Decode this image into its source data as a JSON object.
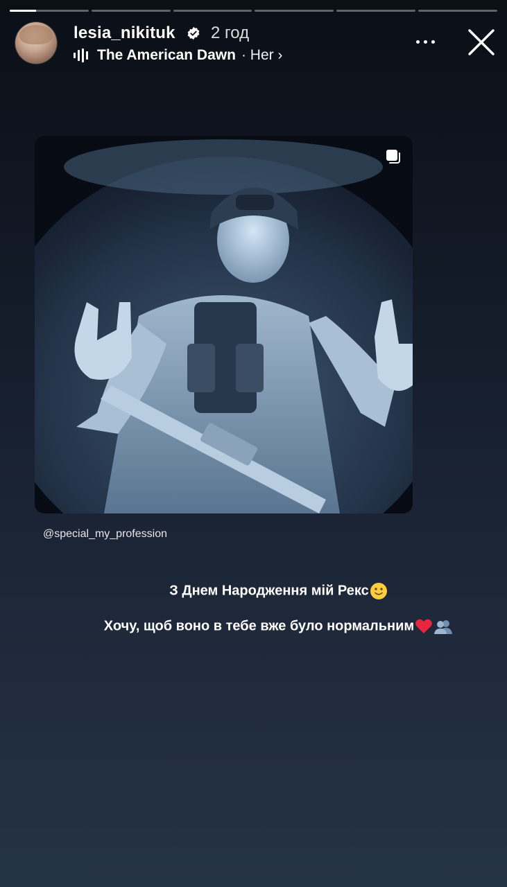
{
  "story": {
    "progress_segments": [
      0.33,
      0,
      0,
      0,
      0,
      0
    ],
    "username": "lesia_nikituk",
    "time_ago": "2 год",
    "music_title": "The American Dawn",
    "music_artist": "· Her",
    "chevron": "›"
  },
  "post": {
    "mention": "@special_my_profession"
  },
  "caption": {
    "line1": "З Днем Народження мій Рекс",
    "line2": "Хочу, щоб воно в тебе вже було нормальним"
  },
  "colors": {
    "accent_heart": "#e8263f",
    "verified": "#ffffff"
  },
  "icons": {
    "verified": "verified-badge-icon",
    "music": "audio-bars-icon",
    "more": "more-dots-icon",
    "close": "close-icon",
    "multi": "multiple-photos-icon",
    "smile": "slightly-smiling-face-emoji",
    "heart": "red-heart-emoji",
    "people": "busts-in-silhouette-emoji"
  }
}
